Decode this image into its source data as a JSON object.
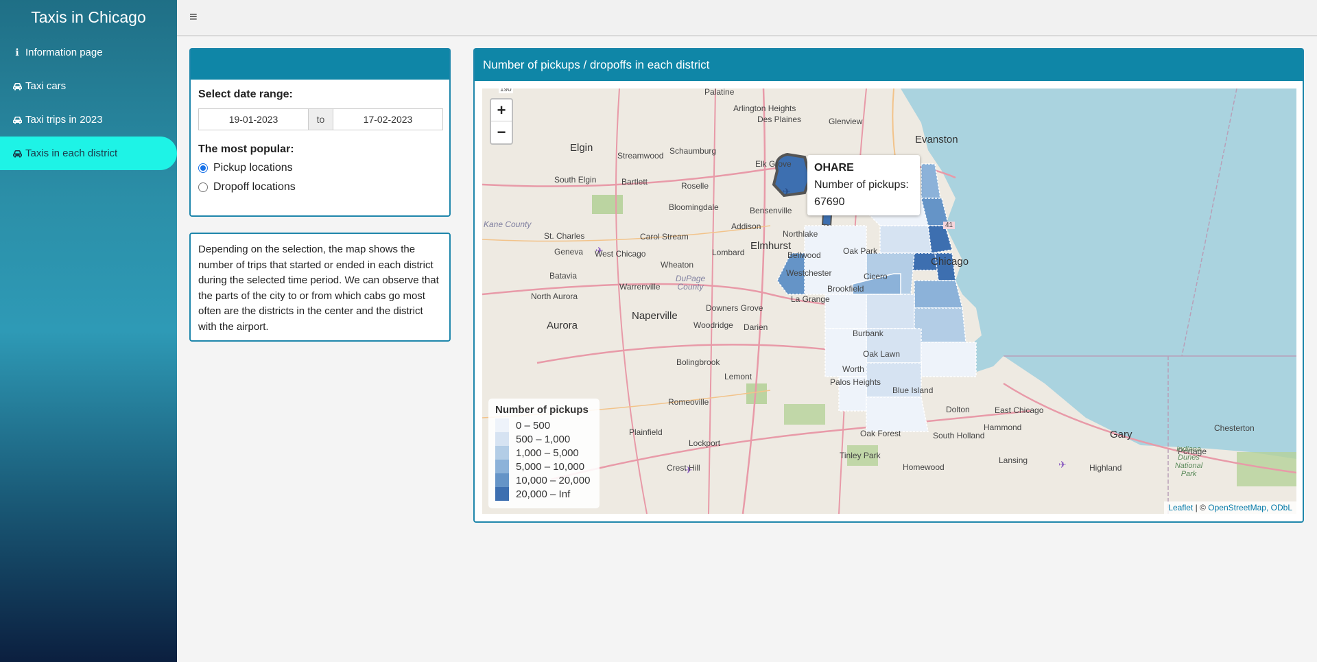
{
  "app": {
    "title": "Taxis in Chicago"
  },
  "sidebar": {
    "items": [
      {
        "label": "Information page",
        "icon": "info-icon"
      },
      {
        "label": "Taxi cars",
        "icon": "car-icon"
      },
      {
        "label": "Taxi trips in 2023",
        "icon": "car-icon"
      },
      {
        "label": "Taxis in each district",
        "icon": "car-icon",
        "active": true
      }
    ]
  },
  "header": {
    "menu_toggle": "≡"
  },
  "controls": {
    "date_label": "Select date range:",
    "date_start": "19-01-2023",
    "date_sep": "to",
    "date_end": "17-02-2023",
    "popular_label": "The most popular:",
    "options": [
      {
        "label": "Pickup locations",
        "selected": true
      },
      {
        "label": "Dropoff locations",
        "selected": false
      }
    ]
  },
  "description": "Depending on the selection, the map shows the number of trips that started or ended in each district during the selected time period. We can observe that the parts of the city to or from which cabs go most often are the districts in the center and the district with the airport.",
  "map_panel": {
    "title": "Number of pickups / dropoffs in each district",
    "zoom_in": "+",
    "zoom_out": "−",
    "tooltip": {
      "district": "OHARE",
      "metric": "Number of pickups:",
      "value": "67690"
    },
    "legend": {
      "title": "Number of pickups",
      "items": [
        {
          "label": "0 – 500",
          "color": "#eef3fa"
        },
        {
          "label": "500 – 1,000",
          "color": "#d6e3f2"
        },
        {
          "label": "1,000 – 5,000",
          "color": "#b3cde6"
        },
        {
          "label": "5,000 – 10,000",
          "color": "#8cb2d9"
        },
        {
          "label": "10,000 – 20,000",
          "color": "#6594c7"
        },
        {
          "label": "20,000 – Inf",
          "color": "#3d6fb0"
        }
      ]
    },
    "attribution": {
      "leaflet": "Leaflet",
      "sep": " | © ",
      "osm": "OpenStreetMap, ODbL"
    },
    "places": [
      "Palatine",
      "Arlington Heights",
      "Glenview",
      "Evanston",
      "Des Plaines",
      "Elgin",
      "Streamwood",
      "Schaumburg",
      "Elk Grove",
      "South Elgin",
      "Bartlett",
      "Roselle",
      "Bloomingdale",
      "Bensenville",
      "Addison",
      "Northlake",
      "St. Charles",
      "Carol Stream",
      "Elmhurst",
      "Oak Park",
      "Chicago",
      "Geneva",
      "West Chicago",
      "Lombard",
      "Bellwood",
      "Batavia",
      "Wheaton",
      "DuPage County",
      "Westchester",
      "Cicero",
      "North Aurora",
      "Warrenville",
      "La Grange",
      "Brookfield",
      "Naperville",
      "Downers Grove",
      "Aurora",
      "Woodridge",
      "Darien",
      "Burbank",
      "Bolingbrook",
      "Lemont",
      "Oak Lawn",
      "Worth",
      "Palos Heights",
      "Blue Island",
      "Romeoville",
      "Dolton",
      "East Chicago",
      "Hammond",
      "Plainfield",
      "Lockport",
      "Oak Forest",
      "South Holland",
      "Gary",
      "Chesterton",
      "Portage",
      "Tinley Park",
      "Homewood",
      "Lansing",
      "Crest Hill",
      "Highland",
      "Indiana Dunes National Park",
      "Kane County",
      "190",
      "41"
    ]
  }
}
